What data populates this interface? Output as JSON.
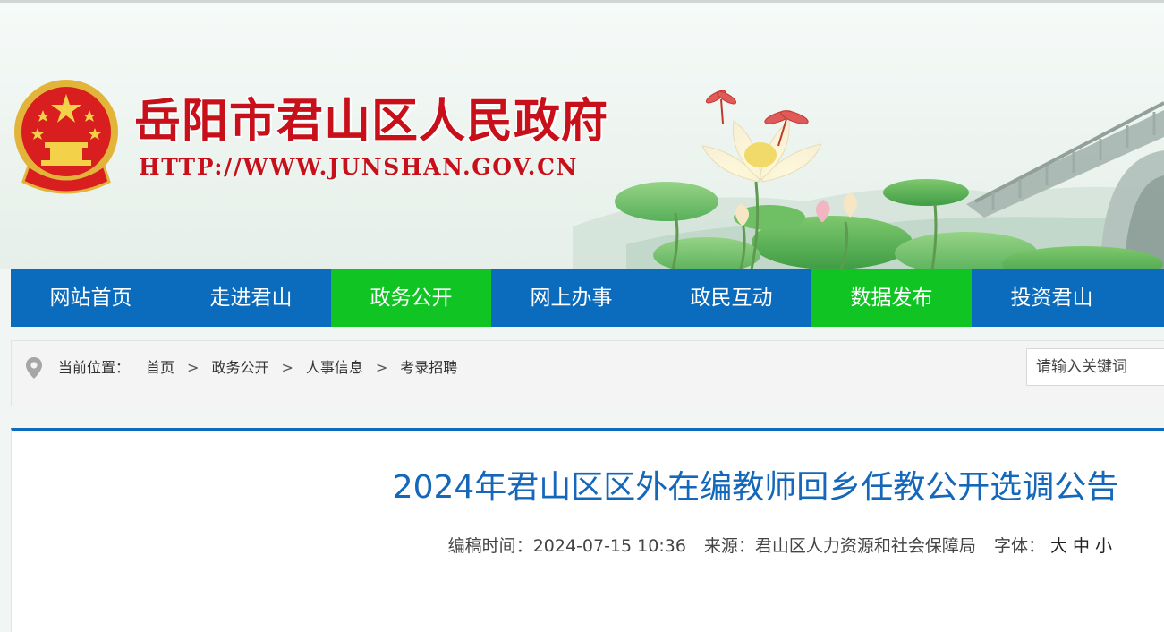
{
  "header": {
    "site_title": "岳阳市君山区人民政府",
    "site_url": "HTTP://WWW.JUNSHAN.GOV.CN",
    "title_color": "#c8101a"
  },
  "nav": {
    "items": [
      {
        "label": "网站首页",
        "active": false
      },
      {
        "label": "走进君山",
        "active": false
      },
      {
        "label": "政务公开",
        "active": true
      },
      {
        "label": "网上办事",
        "active": false
      },
      {
        "label": "政民互动",
        "active": false
      },
      {
        "label": "数据发布",
        "active": true
      },
      {
        "label": "投资君山",
        "active": false
      }
    ],
    "bg_color": "#0b6bbd",
    "active_color": "#10c424"
  },
  "breadcrumb": {
    "label": "当前位置：",
    "items": [
      "首页",
      "政务公开",
      "人事信息",
      "考录招聘"
    ],
    "separator": ">"
  },
  "search": {
    "placeholder": "请输入关键词"
  },
  "article": {
    "title": "2024年君山区区外在编教师回乡任教公开选调公告",
    "meta": {
      "time_label": "编稿时间：",
      "time_value": "2024-07-15 10:36",
      "source_label": "来源：",
      "source_value": "君山区人力资源和社会保障局",
      "font_label": "字体：",
      "font_options": [
        "大",
        "中",
        "小"
      ]
    },
    "title_color": "#1467b9"
  }
}
